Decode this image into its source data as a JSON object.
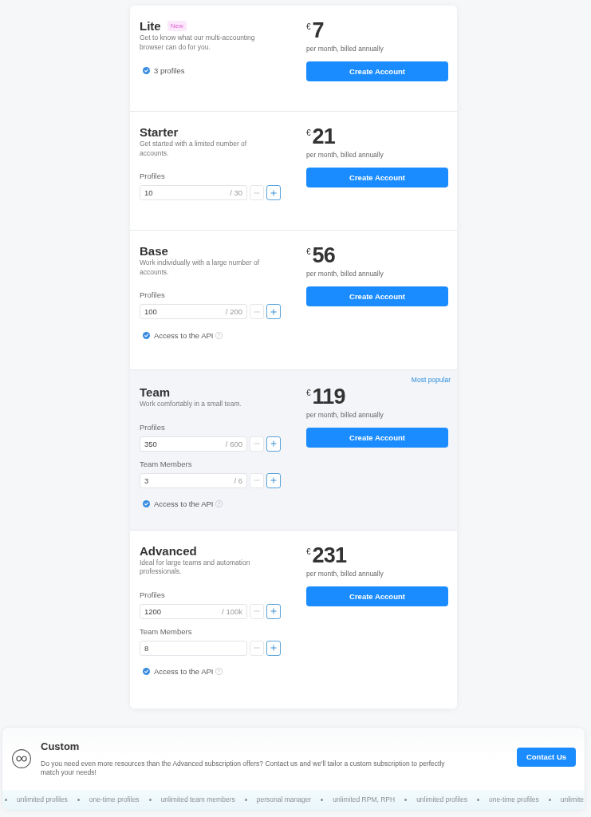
{
  "plans": [
    {
      "name": "Lite",
      "badge": "New",
      "description": "Get to know what our multi-accounting browser can do for you.",
      "currency": "€",
      "price": "7",
      "period": "per month, billed annually",
      "button": "Create Account",
      "popular": false,
      "features": [
        {
          "label": "3 profiles",
          "checked": true,
          "help": false
        }
      ]
    },
    {
      "name": "Starter",
      "description": "Get started with a limited number of accounts.",
      "currency": "€",
      "price": "21",
      "period": "per month, billed annually",
      "button": "Create Account",
      "popular": false,
      "counters": [
        {
          "label": "Profiles",
          "value": "10",
          "limit": "/ 30",
          "decrease_disabled": true,
          "increase_disabled": false
        }
      ]
    },
    {
      "name": "Base",
      "description": "Work individually with a large number of accounts.",
      "currency": "€",
      "price": "56",
      "period": "per month, billed annually",
      "button": "Create Account",
      "popular": false,
      "counters": [
        {
          "label": "Profiles",
          "value": "100",
          "limit": "/ 200",
          "decrease_disabled": true,
          "increase_disabled": false
        }
      ],
      "features": [
        {
          "label": "Access to the API",
          "checked": true,
          "help": true
        }
      ]
    },
    {
      "name": "Team",
      "tag": "Most popular",
      "description": "Work comfortably in a small team.",
      "currency": "€",
      "price": "119",
      "period": "per month, billed annually",
      "button": "Create Account",
      "popular": true,
      "counters": [
        {
          "label": "Profiles",
          "value": "350",
          "limit": "/ 600",
          "decrease_disabled": true,
          "increase_disabled": false
        },
        {
          "label": "Team Members",
          "value": "3",
          "limit": "/ 6",
          "decrease_disabled": true,
          "increase_disabled": false
        }
      ],
      "features": [
        {
          "label": "Access to the API",
          "checked": true,
          "help": true
        }
      ]
    },
    {
      "name": "Advanced",
      "description": "Ideal for large teams and automation professionals.",
      "currency": "€",
      "price": "231",
      "period": "per month, billed annually",
      "button": "Create Account",
      "popular": false,
      "counters": [
        {
          "label": "Profiles",
          "value": "1200",
          "limit": "/ 100k",
          "decrease_disabled": true,
          "increase_disabled": false
        },
        {
          "label": "Team Members",
          "value": "8",
          "decrease_disabled": true,
          "increase_disabled": false
        }
      ],
      "features": [
        {
          "label": "Access to the API",
          "checked": true,
          "help": true
        }
      ]
    }
  ],
  "custom": {
    "title": "Custom",
    "description": "Do you need even more resources than the Advanced subscription offers? Contact us and we'll tailor a custom subscription to perfectly match your needs!",
    "button": "Contact Us"
  },
  "ticker": [
    "unlimited profiles",
    "one-time profiles",
    "unlimited team members",
    "personal manager",
    "unlimited RPM, RPH",
    "unlimited profiles",
    "one-time profiles",
    "unlimite"
  ]
}
